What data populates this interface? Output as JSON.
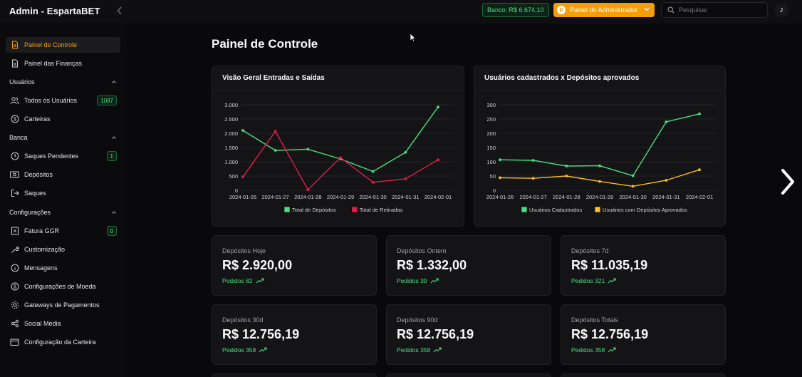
{
  "app": {
    "title": "Admin - EspartaBET",
    "bank_label": "Banco: R$ 6.674,10",
    "admin_button": "Painel do Administrador",
    "admin_button_icon": "P",
    "search_placeholder": "Pesquisar",
    "avatar_initial": "J"
  },
  "colors": {
    "accent": "#f59e0b",
    "green": "#4ade80",
    "red": "#e11d48",
    "yellow": "#fbbf24"
  },
  "sidebar": {
    "item_controle": "Painel de Controle",
    "item_financas": "Painel das Finanças",
    "section_usuarios": "Usuários",
    "item_todos": "Todos os Usuários",
    "count_todos": "1087",
    "item_carteiras": "Carteiras",
    "section_banca": "Banca",
    "item_saques_pend": "Saques Pendentes",
    "count_saques": "1",
    "item_depositos": "Depósitos",
    "item_saques": "Saques",
    "section_config": "Configurações",
    "item_fatura": "Fatura GGR",
    "count_fatura": "0",
    "item_custom": "Customização",
    "item_mensagens": "Mensagens",
    "item_moeda": "Configurações de Moeda",
    "item_gateways": "Gateways de Pagamentos",
    "item_social": "Social Media",
    "item_carteira_cfg": "Configuração da Carteira"
  },
  "main": {
    "page_title": "Painel de Controle"
  },
  "chart_data": [
    {
      "type": "line",
      "title": "Visão Geral Entradas e Saídas",
      "x": [
        "2024-01-26",
        "2024-01-27",
        "2024-01-28",
        "2024-01-29",
        "2024-01-30",
        "2024-01-31",
        "2024-02-01"
      ],
      "yticks": [
        "3.000",
        "2.500",
        "2.000",
        "1.500",
        "1.000",
        "500",
        "0"
      ],
      "ylim": [
        0,
        3000
      ],
      "series": [
        {
          "name": "Total de Depósitos",
          "color": "#4ade80",
          "values": [
            2100,
            1400,
            1440,
            1100,
            660,
            1330,
            2920
          ]
        },
        {
          "name": "Total de Retiradas",
          "color": "#e11d48",
          "values": [
            470,
            2070,
            20,
            1150,
            280,
            400,
            1070
          ]
        }
      ],
      "legend": "bottom"
    },
    {
      "type": "line",
      "title": "Usuários cadastrados x Depósitos aprovados",
      "x": [
        "2024-01-26",
        "2024-01-27",
        "2024-01-28",
        "2024-01-29",
        "2024-01-30",
        "2024-01-31",
        "2024-02-01"
      ],
      "yticks": [
        "300",
        "250",
        "200",
        "150",
        "100",
        "50",
        "0"
      ],
      "ylim": [
        0,
        300
      ],
      "series": [
        {
          "name": "Usuários Cadastrados",
          "color": "#4ade80",
          "values": [
            107,
            105,
            85,
            86,
            51,
            240,
            268
          ]
        },
        {
          "name": "Usuários com Depósitos Aprovados",
          "color": "#fbbf24",
          "values": [
            44,
            42,
            50,
            31,
            14,
            35,
            72
          ]
        }
      ],
      "legend": "bottom"
    }
  ],
  "stats": [
    {
      "label": "Depósitos Hoje",
      "value": "R$ 2.920,00",
      "orders": "Pedidos 82"
    },
    {
      "label": "Depósitos Ontem",
      "value": "R$ 1.332,00",
      "orders": "Pedidos 39"
    },
    {
      "label": "Depósitos 7d",
      "value": "R$ 11.035,19",
      "orders": "Pedidos 321"
    },
    {
      "label": "Depósitos 30d",
      "value": "R$ 12.756,19",
      "orders": "Pedidos 358"
    },
    {
      "label": "Depósitos 90d",
      "value": "R$ 12.756,19",
      "orders": "Pedidos 358"
    },
    {
      "label": "Depósitos Totais",
      "value": "R$ 12.756,19",
      "orders": "Pedidos 358"
    }
  ]
}
